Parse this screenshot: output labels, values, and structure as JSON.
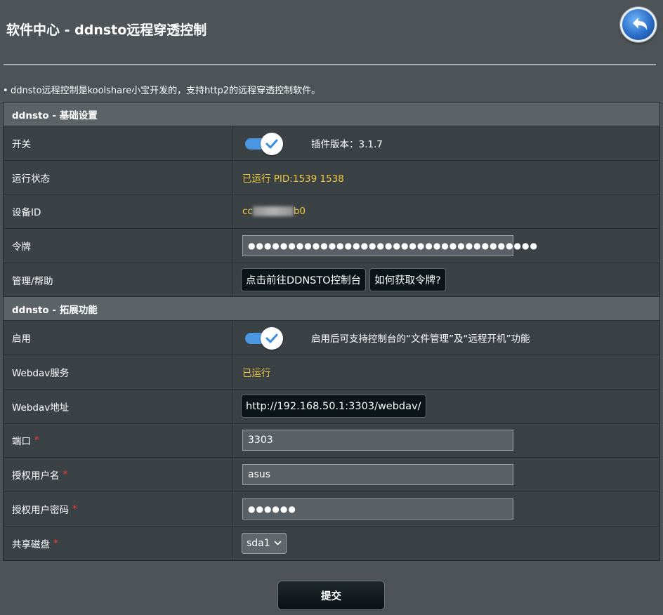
{
  "page": {
    "title": "软件中心 - ddnsto远程穿透控制",
    "description": "ddnsto远程控制是koolshare小宝开发的，支持http2的远程穿透控制软件。"
  },
  "basic": {
    "header": "ddnsto - 基础设置",
    "switch": {
      "label": "开关",
      "checked": true,
      "version_text": "插件版本：3.1.7"
    },
    "status": {
      "label": "运行状态",
      "value": "已运行 PID:1539 1538"
    },
    "device_id": {
      "label": "设备ID",
      "value_prefix": "cc",
      "value_suffix": "b0"
    },
    "token": {
      "label": "令牌",
      "value": "●●●●●●●●●●●●●●●●●●●●●●●●●●●●●●●●●●●●"
    },
    "manage": {
      "label": "管理/帮助",
      "console_button": "点击前往DDNSTO控制台",
      "help_button": "如何获取令牌?"
    }
  },
  "extended": {
    "header": "ddnsto - 拓展功能",
    "enable": {
      "label": "启用",
      "checked": true,
      "hint": "启用后可支持控制台的“文件管理”及“远程开机”功能"
    },
    "webdav_service": {
      "label": "Webdav服务",
      "value": "已运行"
    },
    "webdav_address": {
      "label": "Webdav地址",
      "value": "http://192.168.50.1:3303/webdav/"
    },
    "port": {
      "label": "端口",
      "required_mark": "*",
      "value": "3303"
    },
    "username": {
      "label": "授权用户名",
      "required_mark": "*",
      "value": "asus"
    },
    "password": {
      "label": "授权用户密码",
      "required_mark": "*",
      "value": "●●●●●●"
    },
    "disk": {
      "label": "共享磁盘",
      "required_mark": "*",
      "selected": "sda1"
    }
  },
  "submit_label": "提交",
  "colors": {
    "accent_blue": "#4b96e2",
    "status_yellow": "#f1c73d",
    "required_red": "#ff3b3b"
  }
}
